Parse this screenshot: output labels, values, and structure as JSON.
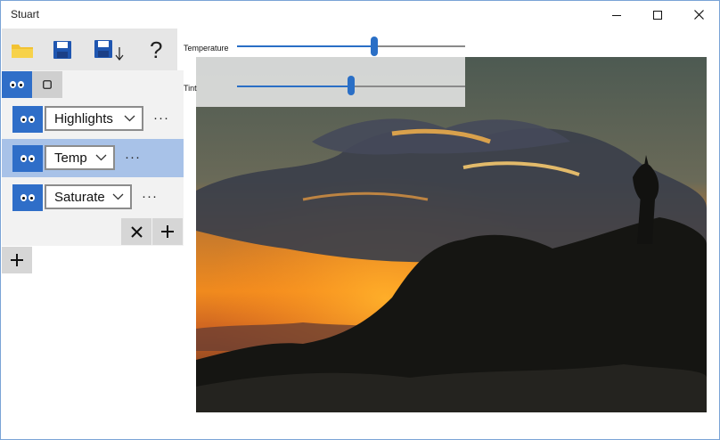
{
  "window": {
    "title": "Stuart"
  },
  "controls": {
    "minimize": "minimize-icon",
    "maximize": "maximize-icon",
    "close": "close-icon"
  },
  "toolbar": {
    "buttons": [
      {
        "name": "open-folder",
        "icon": "folder-icon"
      },
      {
        "name": "save",
        "icon": "floppy-disk-icon"
      },
      {
        "name": "save-as",
        "icon": "floppy-disk-download-icon"
      },
      {
        "name": "help",
        "icon": "question-mark-icon"
      }
    ]
  },
  "sliders": [
    {
      "label": "Temperature",
      "value": 0.6
    },
    {
      "label": "Tint",
      "value": 0.5
    }
  ],
  "layers": [
    {
      "name": "Highlights",
      "selected": false
    },
    {
      "name": "Temp",
      "selected": true
    },
    {
      "name": "Saturate",
      "selected": false
    }
  ],
  "more_glyph": "···",
  "colors": {
    "accent": "#2f6ec8",
    "selected_row": "#a8c2e8",
    "toolbar_bg": "#e6e6e6"
  }
}
